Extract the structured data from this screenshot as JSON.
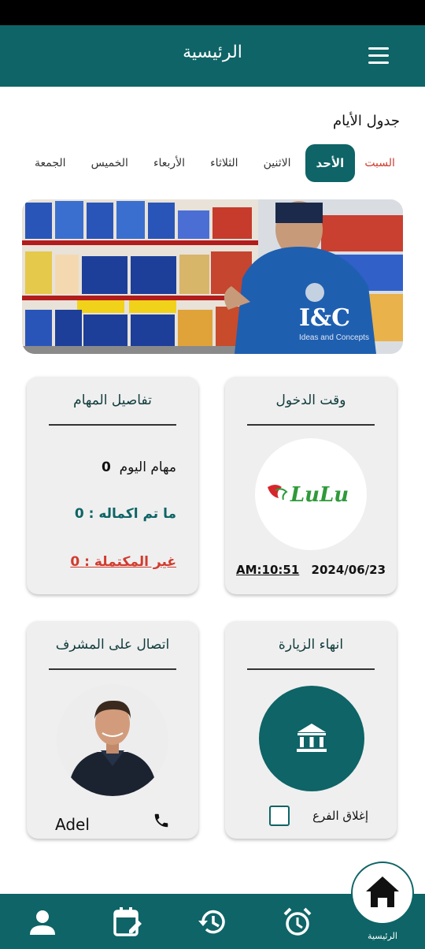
{
  "header": {
    "title": "الرئيسية"
  },
  "days": {
    "title": "جدول الأيام",
    "items": [
      {
        "label": "السبت",
        "state": "today"
      },
      {
        "label": "الأحد",
        "state": "active"
      },
      {
        "label": "الاثنين",
        "state": ""
      },
      {
        "label": "الثلاثاء",
        "state": ""
      },
      {
        "label": "الأربعاء",
        "state": ""
      },
      {
        "label": "الخميس",
        "state": ""
      },
      {
        "label": "الجمعة",
        "state": ""
      }
    ]
  },
  "banner": {
    "brand": "I&C",
    "tagline": "Ideas and Concepts"
  },
  "entry_card": {
    "title": "وقت الدخول",
    "store_logo": "LuLu",
    "date": "2024/06/23",
    "time": "AM:10:51"
  },
  "tasks_card": {
    "title": "تفاصيل المهام",
    "today_label": "مهام اليوم",
    "today_value": "0",
    "done_label": "ما تم اكماله :",
    "done_value": "0",
    "undone_label": "غير المكتملة :",
    "undone_value": "0"
  },
  "end_visit_card": {
    "title": "انهاء الزيارة",
    "close_branch_label": "إغلاق الفرع",
    "close_branch_checked": false
  },
  "supervisor_card": {
    "title": "اتصال على المشرف",
    "name": "Adel"
  },
  "bottom_nav": {
    "home_label": "الرئيسية"
  },
  "colors": {
    "primary": "#0e6466",
    "danger": "#d13b2e",
    "card": "#efefef",
    "lulu_green": "#2f9a3a",
    "lulu_red": "#d7262b"
  },
  "icons": [
    "menu-icon",
    "bank-icon",
    "phone-icon",
    "person-icon",
    "calendar-edit-icon",
    "history-icon",
    "alarm-icon",
    "home-icon"
  ]
}
